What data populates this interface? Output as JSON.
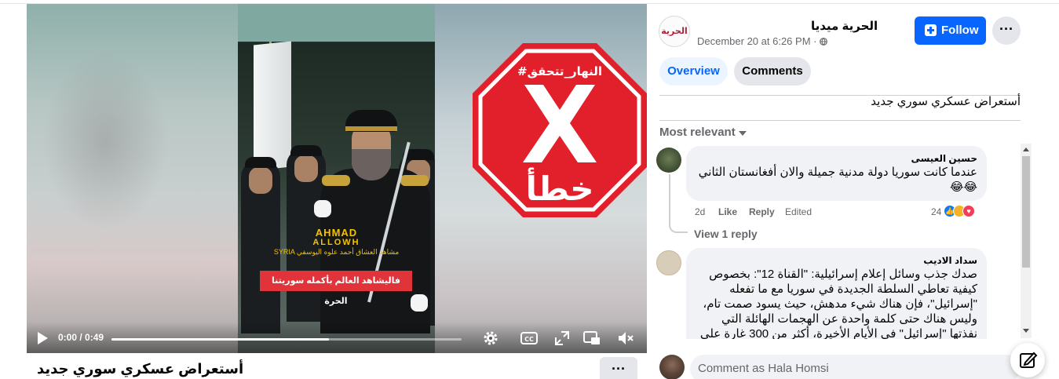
{
  "video": {
    "overlay": {
      "brand_line1": "AHMAD",
      "brand_line2": "ALLOWH",
      "brand_line3": "SYRIA",
      "brand_arabic": "مشاهد العشاق أحمد علوه اليوسفي",
      "caption": "فاليشاهد العالم بأكمله سوريتنا الحرة"
    },
    "stop_sign": {
      "hashtag": "#النهار_تتحقق",
      "verdict": "خطأ",
      "color": "#e2202b"
    },
    "controls": {
      "time": "0:00 / 0:49",
      "progress_fraction": 0.62
    }
  },
  "post": {
    "title": "أستعراض عسكري سوري جديد",
    "text": "أستعراض عسكري سوري جديد"
  },
  "page": {
    "avatar_label": "الحرية",
    "name": "الحرية ميديا",
    "date": "December 20 at 6:26 PM · "
  },
  "follow_label": "Follow",
  "more_label": "···",
  "tabs": {
    "overview": "Overview",
    "comments": "Comments"
  },
  "sort_label": "Most relevant",
  "comments": [
    {
      "author": "حسين العيسى",
      "text_line1": "عندما كانت سوريا دولة مدنية جميلة والان أفغانستان الثاني",
      "text_line2": "😂😂",
      "time": "2d",
      "like": "Like",
      "reply": "Reply",
      "edited": "Edited",
      "reaction_count": "24",
      "view_replies": "View 1 reply"
    },
    {
      "author": "سداد الاديب",
      "lines": [
        "صدك جذب وسائل إعلام إسرائيلية: \"القناة 12\": بخصوص",
        "كيفية تعاطي السلطة الجديدة في سوريا مع ما تفعله",
        "\"إسرائيل\"، فإن هناك شيء مدهش، حيث يسود صمت تام،",
        "وليس هناك حتى كلمة واحدة عن الهجمات الهائلة التي",
        "نفذتها \"إسرائيل\" في الأيام الأخيرة، أكثر من 300 غارة على"
      ]
    }
  ],
  "composer": {
    "placeholder": "Comment as Hala Homsi"
  },
  "colors": {
    "accent": "#0866ff",
    "bubble": "#f0f2f5",
    "muted": "#65676b"
  }
}
